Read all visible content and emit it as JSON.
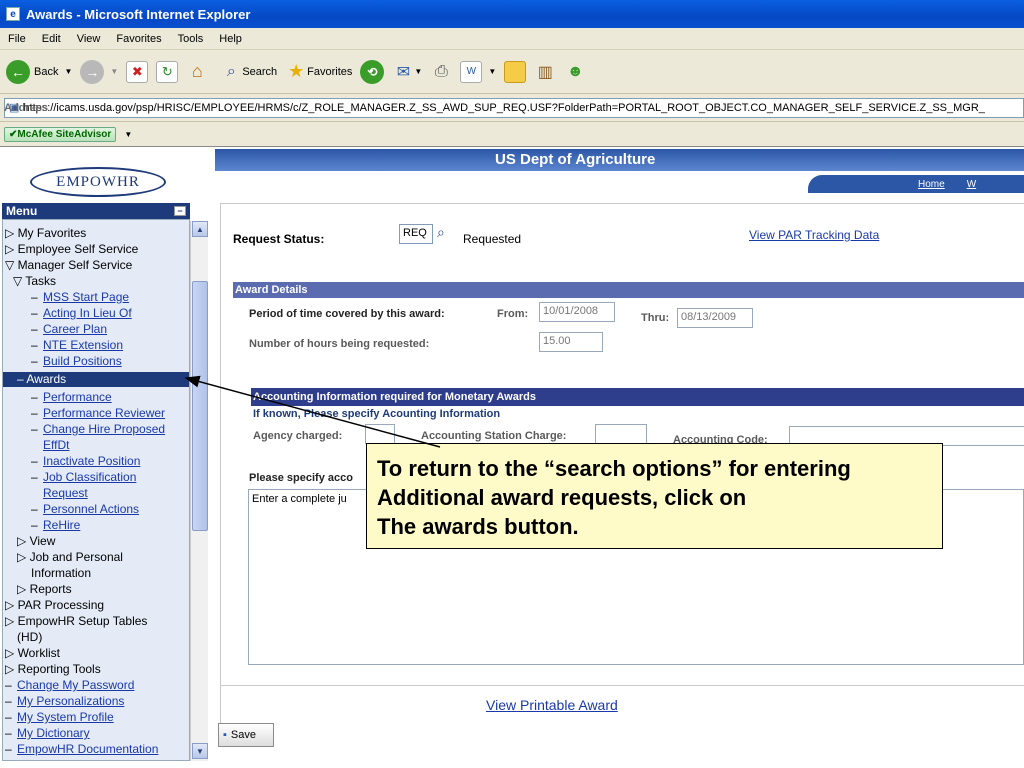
{
  "window": {
    "title": "Awards - Microsoft Internet Explorer"
  },
  "menubar": [
    "File",
    "Edit",
    "View",
    "Favorites",
    "Tools",
    "Help"
  ],
  "toolbar": {
    "back": "Back",
    "search": "Search",
    "favorites": "Favorites"
  },
  "address": {
    "label": "Address",
    "url": "https://icams.usda.gov/psp/HRISC/EMPLOYEE/HRMS/c/Z_ROLE_MANAGER.Z_SS_AWD_SUP_REQ.USF?FolderPath=PORTAL_ROOT_OBJECT.CO_MANAGER_SELF_SERVICE.Z_SS_MGR_"
  },
  "mcafee": "McAfee SiteAdvisor",
  "header": {
    "logo": "EMPOWHR",
    "org": "US Dept of Agriculture",
    "nav_home": "Home",
    "nav_w": "W"
  },
  "menu": {
    "title": "Menu",
    "items": [
      {
        "label": "▷ My Favorites"
      },
      {
        "label": "▷ Employee Self Service"
      },
      {
        "label": "▽ Manager Self Service"
      },
      {
        "label": "▽ Tasks"
      },
      {
        "label": "MSS Start Page"
      },
      {
        "label": "Acting In Lieu Of"
      },
      {
        "label": "Career Plan"
      },
      {
        "label": "NTE Extension"
      },
      {
        "label": "Build Positions"
      },
      {
        "label": "Awards"
      },
      {
        "label": "Performance"
      },
      {
        "label": "Performance Reviewer"
      },
      {
        "label": "Change Hire Proposed"
      },
      {
        "label": "EffDt"
      },
      {
        "label": "Inactivate Position"
      },
      {
        "label": "Job Classification"
      },
      {
        "label": "Request"
      },
      {
        "label": "Personnel Actions"
      },
      {
        "label": "ReHire"
      },
      {
        "label": "▷ View"
      },
      {
        "label": "▷ Job and Personal"
      },
      {
        "label": "Information"
      },
      {
        "label": "▷ Reports"
      },
      {
        "label": "▷ PAR Processing"
      },
      {
        "label": "▷ EmpowHR Setup Tables"
      },
      {
        "label": "(HD)"
      },
      {
        "label": "▷ Worklist"
      },
      {
        "label": "▷ Reporting Tools"
      },
      {
        "label": "Change My Password"
      },
      {
        "label": "My Personalizations"
      },
      {
        "label": "My System Profile"
      },
      {
        "label": "My Dictionary"
      },
      {
        "label": "EmpowHR Documentation"
      }
    ]
  },
  "request": {
    "status_label": "Request Status:",
    "status_code": "REQ",
    "status_text": "Requested",
    "tracking_link": "View PAR Tracking Data"
  },
  "award": {
    "section": "Award Details",
    "period_label": "Period of time covered by this award:",
    "from_label": "From:",
    "from_value": "10/01/2008",
    "thru_label": "Thru:",
    "thru_value": "08/13/2009",
    "hours_label": "Number of hours being requested:",
    "hours_value": "15.00"
  },
  "accounting": {
    "section": "Accounting Information required for Monetary Awards",
    "known": "If known, Please specify Acounting Information",
    "agency_label": "Agency charged:",
    "station_label": "Accounting Station Charge:",
    "code_label": "Accounting Code:"
  },
  "justification": {
    "label": "Please specify acco",
    "text": "Enter a complete ju"
  },
  "links": {
    "printable": "View Printable Award"
  },
  "save": "Save",
  "callout": {
    "line1": "To return to the “search options” for entering",
    "line2": "Additional award requests, click on",
    "line3": "The awards button."
  }
}
